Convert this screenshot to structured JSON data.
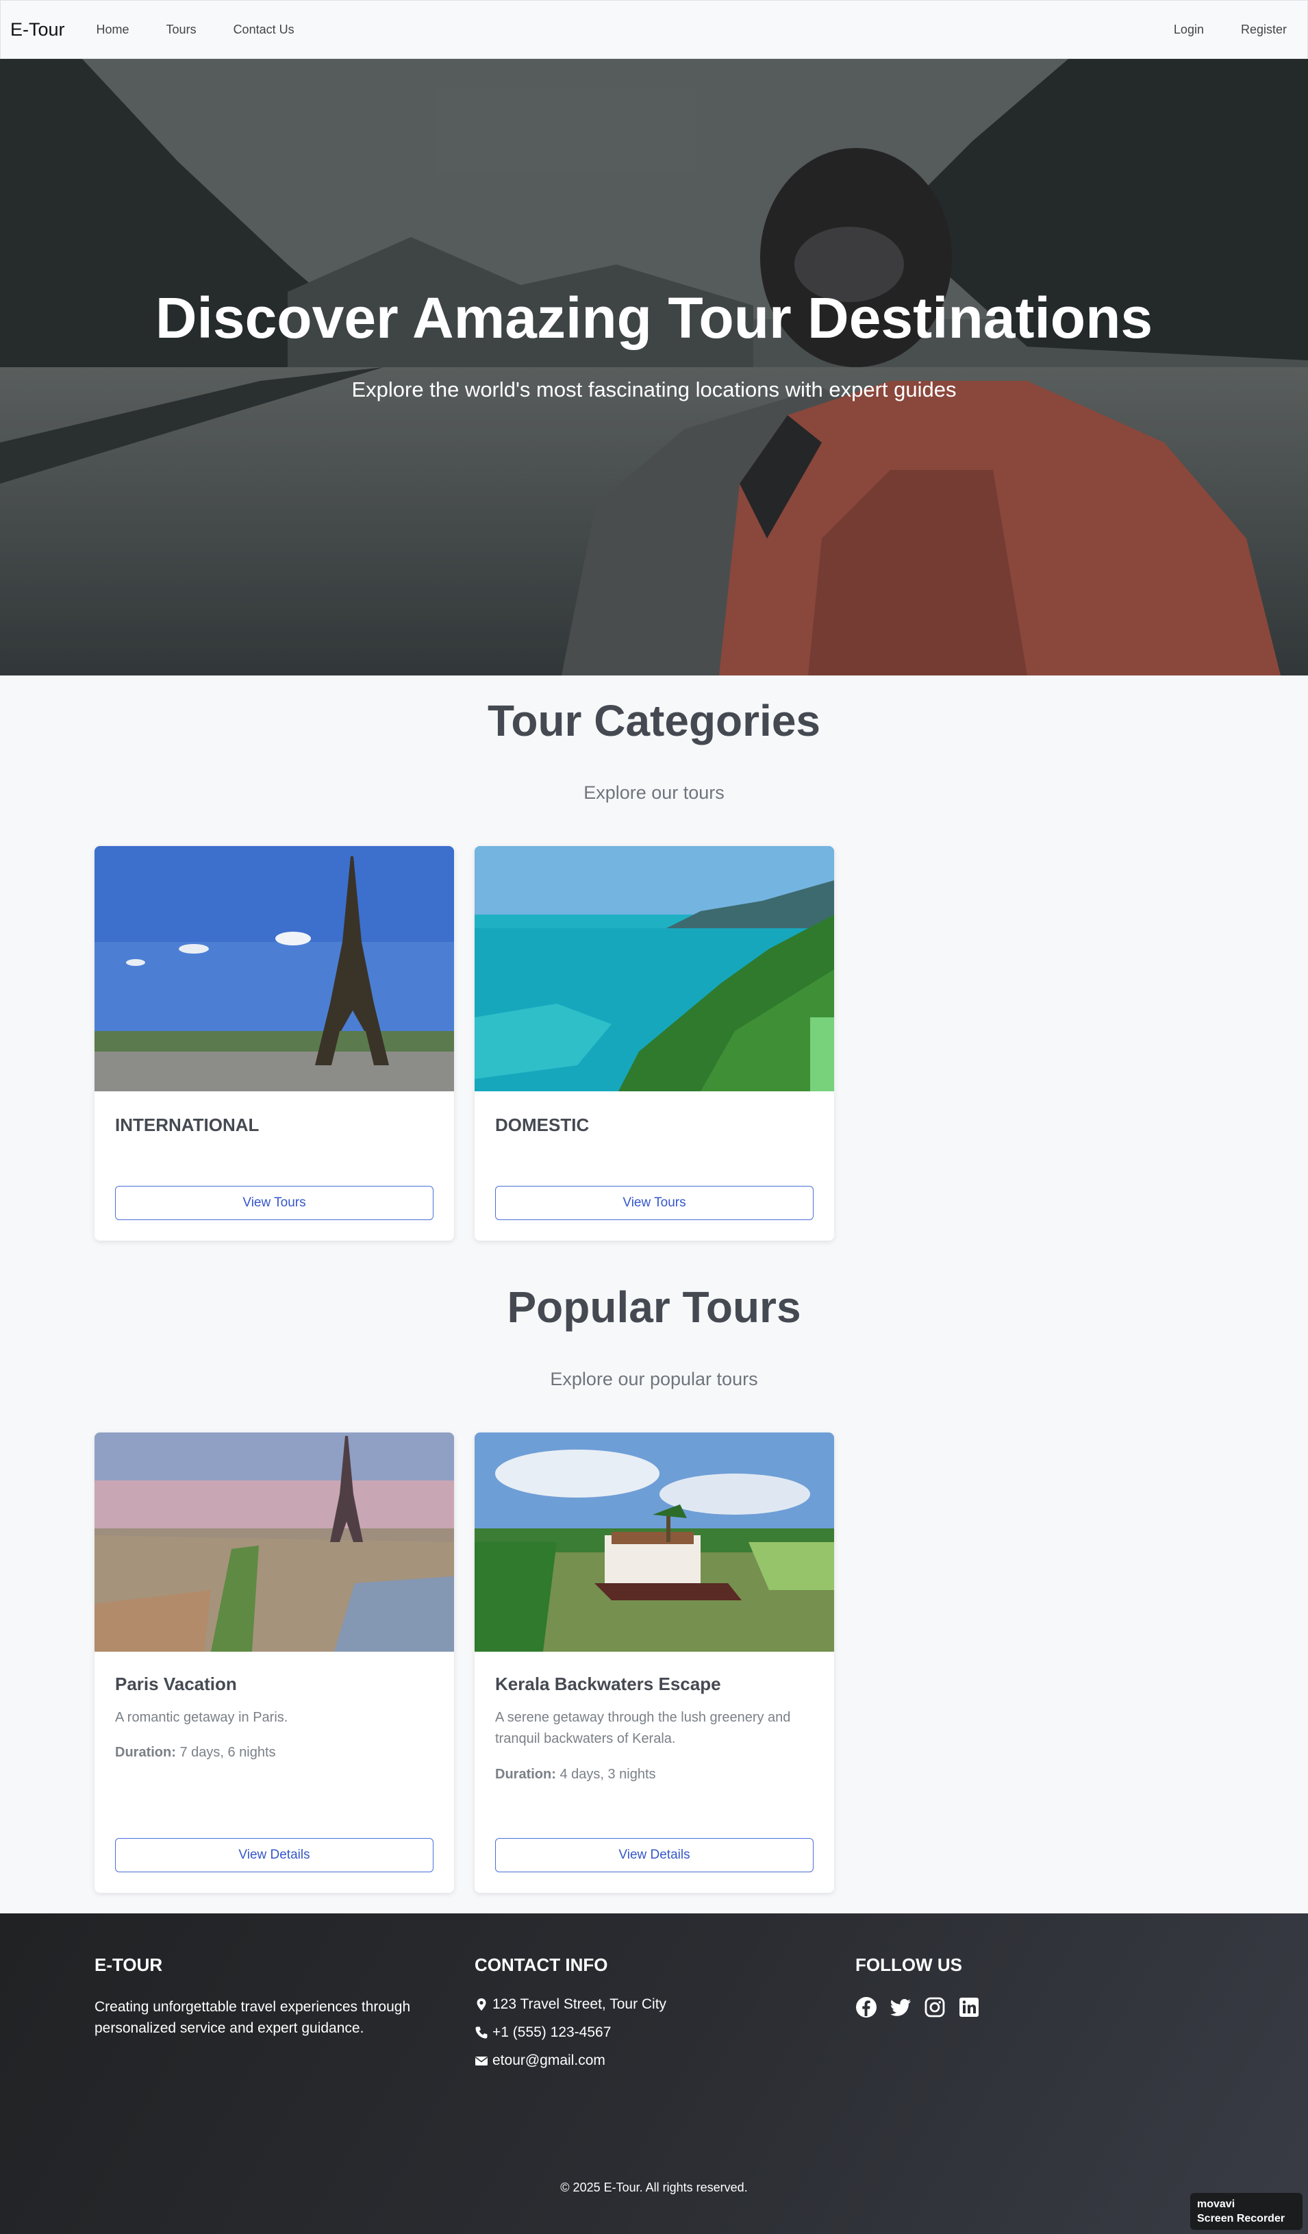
{
  "navbar": {
    "brand": "E-Tour",
    "links": [
      "Home",
      "Tours",
      "Contact Us"
    ],
    "login": "Login",
    "register": "Register"
  },
  "hero": {
    "title": "Discover Amazing Tour Destinations",
    "subtitle": "Explore the world's most fascinating locations with expert guides"
  },
  "categories": {
    "title": "Tour Categories",
    "subtitle": "Explore our tours",
    "items": [
      {
        "name": "INTERNATIONAL",
        "button": "View Tours"
      },
      {
        "name": "DOMESTIC",
        "button": "View Tours"
      }
    ]
  },
  "popular": {
    "title": "Popular Tours",
    "subtitle": "Explore our popular tours",
    "items": [
      {
        "name": "Paris Vacation",
        "description": "A romantic getaway in Paris.",
        "duration_label": "Duration:",
        "duration": "7 days, 6 nights",
        "button": "View Details"
      },
      {
        "name": "Kerala Backwaters Escape",
        "description": "A serene getaway through the lush greenery and tranquil backwaters of Kerala.",
        "duration_label": "Duration:",
        "duration": "4 days, 3 nights",
        "button": "View Details"
      }
    ]
  },
  "footer": {
    "brand": "E-TOUR",
    "about": "Creating unforgettable travel experiences through personalized service and expert guidance.",
    "contact_title": "CONTACT INFO",
    "address": "123 Travel Street, Tour City",
    "phone": "+1 (555) 123-4567",
    "email": "etour@gmail.com",
    "follow_title": "FOLLOW US",
    "socials": [
      "facebook-icon",
      "twitter-icon",
      "instagram-icon",
      "linkedin-icon"
    ],
    "copyright": "© 2025 E-Tour. All rights reserved."
  },
  "watermark": {
    "line1": "movavi",
    "line2": "Screen Recorder"
  },
  "colors": {
    "accent": "#3557c8",
    "footer_bg": "#2a2c31"
  }
}
